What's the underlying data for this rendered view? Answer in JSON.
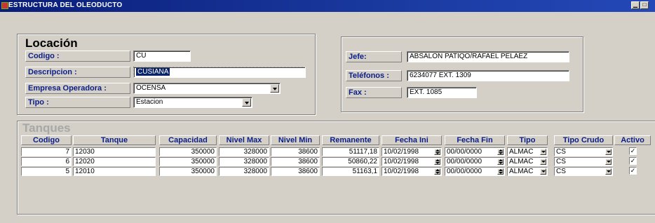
{
  "window": {
    "title": "ESTRUCTURA DEL OLEODUCTO"
  },
  "location": {
    "section_title": "Locación",
    "codigo_label": "Codigo :",
    "codigo_value": "CU",
    "descripcion_label": "Descripcion :",
    "descripcion_value": "CUSIANA",
    "empresa_label": "Empresa Operadora :",
    "empresa_value": "OCENSA",
    "tipo_label": "Tipo :",
    "tipo_value": "Estacion"
  },
  "contact": {
    "jefe_label": "Jefe:",
    "jefe_value": "ABSALON PATIQO/RAFAEL PELAEZ",
    "telefonos_label": "Teléfonos :",
    "telefonos_value": "6234077 EXT. 1309",
    "fax_label": "Fax :",
    "fax_value": "EXT. 1085"
  },
  "tanques": {
    "section_title": "Tanques",
    "headers": [
      "Codigo",
      "Tanque",
      "Capacidad",
      "Nivel Max",
      "Nivel Min",
      "Remanente",
      "Fecha Ini",
      "Fecha Fin",
      "Tipo",
      "Tipo Crudo",
      "Activo"
    ],
    "rows": [
      {
        "codigo": "7",
        "tanque": "12030",
        "capacidad": "350000",
        "nivel_max": "328000",
        "nivel_min": "38600",
        "remanente": "51117,18",
        "fecha_ini": "10/02/1998",
        "fecha_fin": "00/00/0000",
        "tipo": "ALMAC",
        "tipo_crudo": "CS",
        "activo": "✓"
      },
      {
        "codigo": "6",
        "tanque": "12020",
        "capacidad": "350000",
        "nivel_max": "328000",
        "nivel_min": "38600",
        "remanente": "50860,22",
        "fecha_ini": "10/02/1998",
        "fecha_fin": "00/00/0000",
        "tipo": "ALMAC",
        "tipo_crudo": "CS",
        "activo": "✓"
      },
      {
        "codigo": "5",
        "tanque": "12010",
        "capacidad": "350000",
        "nivel_max": "328000",
        "nivel_min": "38600",
        "remanente": "51163,1",
        "fecha_ini": "10/02/1998",
        "fecha_fin": "00/00/0000",
        "tipo": "ALMAC",
        "tipo_crudo": "CS",
        "activo": "✓"
      }
    ]
  },
  "colors": {
    "title_bar": "#0a1e7a",
    "label_text": "#0a1e8a",
    "face": "#d4d0c8",
    "selection": "#0a246a"
  }
}
